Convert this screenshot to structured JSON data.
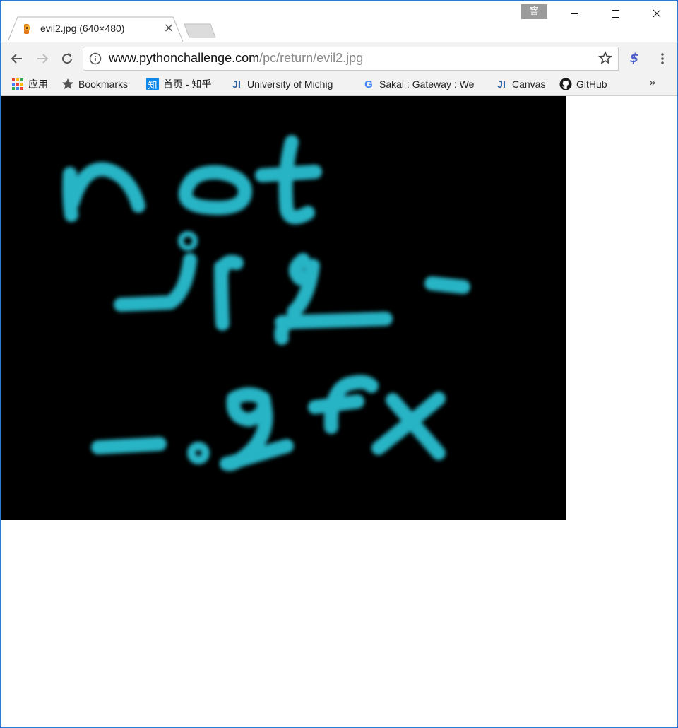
{
  "window": {
    "profile_badge": "窨",
    "controls": [
      "minimize",
      "maximize",
      "close"
    ]
  },
  "tab": {
    "title": "evil2.jpg (640×480)",
    "favicon": "python-challenge-favicon",
    "close_label": "×"
  },
  "omnibox": {
    "url_host": "www.pythonchallenge.com",
    "url_path": "/pc/return/evil2.jpg"
  },
  "toolbar": {
    "back_icon": "arrow-left",
    "forward_icon": "arrow-right",
    "reload_icon": "reload",
    "extension_label": "$"
  },
  "bookmarks": {
    "items": [
      {
        "label": "应用",
        "icon": "apps-grid"
      },
      {
        "label": "Bookmarks",
        "icon": "star"
      },
      {
        "label": "首页 - 知乎",
        "icon": "zhihu",
        "icon_text": "知"
      },
      {
        "label": "University of Michig",
        "icon": "ji",
        "icon_text": "JI"
      },
      {
        "label": "Sakai : Gateway : We",
        "icon": "google",
        "icon_text": "G"
      },
      {
        "label": "Canvas",
        "icon": "ji",
        "icon_text": "JI"
      },
      {
        "label": "GitHub",
        "icon": "github"
      }
    ],
    "overflow_label": "»"
  },
  "image": {
    "background": "#000000",
    "stroke_color": "#2fd4e8"
  }
}
